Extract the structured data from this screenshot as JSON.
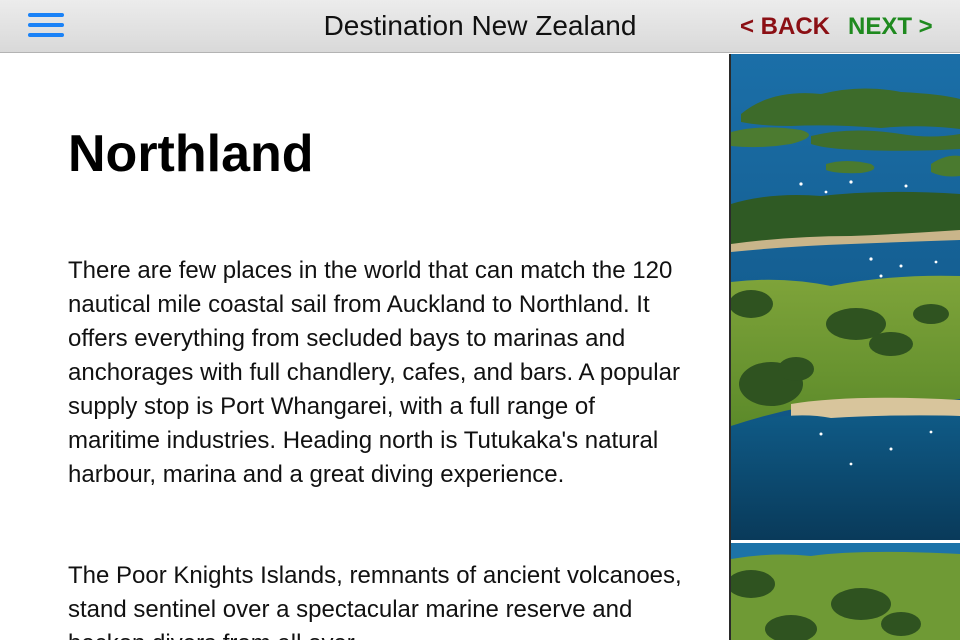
{
  "navbar": {
    "menu_icon": "hamburger-menu-icon",
    "title": "Destination New Zealand",
    "back_label": "< BACK",
    "next_label": "NEXT >",
    "colors": {
      "menu_icon": "#1a82f7",
      "back": "#8b0f14",
      "next": "#1f8a1f"
    }
  },
  "article": {
    "title": "Northland",
    "paragraphs": [
      "There are few places in the world that can match the 120 nautical mile coastal sail from Auckland to Northland. It offers everything from secluded bays to marinas and anchorages with full chandlery, cafes, and bars. A popular supply stop is Port Whangarei, with a full range of maritime industries. Heading north is Tutukaka's natural harbour, marina and a great diving experience.",
      "The Poor Knights Islands, remnants of ancient volcanoes, stand sentinel over a spectacular marine reserve and beckon divers from all over"
    ]
  },
  "photos": [
    "aerial-bay-of-islands-photo",
    "aerial-green-hills-bay-photo"
  ]
}
